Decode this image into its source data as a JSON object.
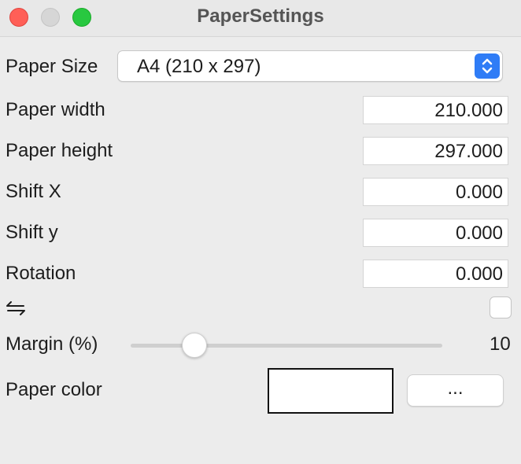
{
  "window": {
    "title": "PaperSettings"
  },
  "paper_size": {
    "label": "Paper Size",
    "selected": "A4 (210 x 297)"
  },
  "fields": {
    "paper_width": {
      "label": "Paper width",
      "value": "210.000"
    },
    "paper_height": {
      "label": "Paper height",
      "value": "297.000"
    },
    "shift_x": {
      "label": "Shift X",
      "value": "0.000"
    },
    "shift_y": {
      "label": "Shift y",
      "value": "0.000"
    },
    "rotation": {
      "label": "Rotation",
      "value": "0.000"
    }
  },
  "swap": {
    "icon": "swap-arrows-icon",
    "checked": false
  },
  "margin": {
    "label": "Margin (%)",
    "value": "10",
    "level": 0.2
  },
  "paper_color": {
    "label": "Paper color",
    "color": "#ffffff",
    "button_label": "..."
  }
}
